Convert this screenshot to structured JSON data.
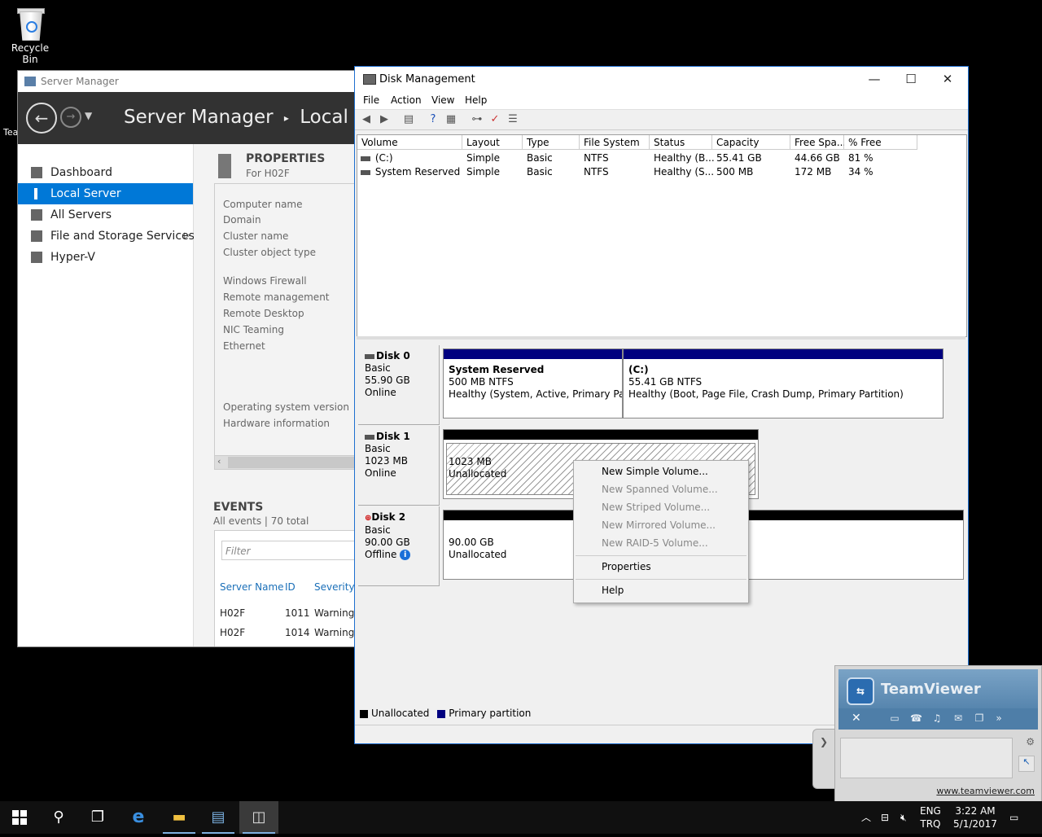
{
  "desktop": {
    "recycle_bin": "Recycle Bin",
    "partial_icon_label": "Tea"
  },
  "server_manager": {
    "window_title": "Server Manager",
    "breadcrumb_root": "Server Manager",
    "breadcrumb_separator": "▸",
    "breadcrumb_current": "Local Serv",
    "nav": [
      {
        "label": "Dashboard",
        "icon": "dashboard-icon"
      },
      {
        "label": "Local Server",
        "icon": "server-icon"
      },
      {
        "label": "All Servers",
        "icon": "servers-icon"
      },
      {
        "label": "File and Storage Services",
        "icon": "storage-icon"
      },
      {
        "label": "Hyper-V",
        "icon": "hyperv-icon"
      }
    ],
    "properties": {
      "heading": "PROPERTIES",
      "subheading": "For H02F",
      "labels": [
        "Computer name",
        "Domain",
        "Cluster name",
        "Cluster object type",
        "Windows Firewall",
        "Remote management",
        "Remote Desktop",
        "NIC Teaming",
        "Ethernet",
        "Operating system version",
        "Hardware information"
      ]
    },
    "events": {
      "heading": "EVENTS",
      "subheading": "All events | 70 total",
      "filter_placeholder": "Filter",
      "columns": [
        "Server Name",
        "ID",
        "Severity"
      ],
      "rows": [
        [
          "H02F",
          "1011",
          "Warning"
        ],
        [
          "H02F",
          "1014",
          "Warning"
        ]
      ]
    }
  },
  "disk_management": {
    "window_title": "Disk Management",
    "menu": [
      "File",
      "Action",
      "View",
      "Help"
    ],
    "columns": [
      "Volume",
      "Layout",
      "Type",
      "File System",
      "Status",
      "Capacity",
      "Free Spa...",
      "% Free"
    ],
    "volumes": [
      [
        "(C:)",
        "Simple",
        "Basic",
        "NTFS",
        "Healthy (B...",
        "55.41 GB",
        "44.66 GB",
        "81 %"
      ],
      [
        "System Reserved",
        "Simple",
        "Basic",
        "NTFS",
        "Healthy (S...",
        "500 MB",
        "172 MB",
        "34 %"
      ]
    ],
    "disks": [
      {
        "name": "Disk 0",
        "type": "Basic",
        "size": "55.90 GB",
        "state": "Online",
        "partitions": [
          {
            "title": "System Reserved",
            "size": "500 MB NTFS",
            "status": "Healthy (System, Active, Primary Partiti"
          },
          {
            "title": "(C:)",
            "size": "55.41 GB NTFS",
            "status": "Healthy (Boot, Page File, Crash Dump, Primary Partition)"
          }
        ]
      },
      {
        "name": "Disk 1",
        "type": "Basic",
        "size": "1023 MB",
        "state": "Online",
        "partitions": [
          {
            "size": "1023 MB",
            "status": "Unallocated"
          }
        ]
      },
      {
        "name": "Disk 2",
        "type": "Basic",
        "size": "90.00 GB",
        "state": "Offline",
        "partitions": [
          {
            "size": "90.00 GB",
            "status": "Unallocated"
          }
        ]
      }
    ],
    "legend": [
      "Unallocated",
      "Primary partition"
    ],
    "colors": {
      "unallocated": "#000000",
      "primary": "#00007f",
      "title_border": "#1e6fd0"
    }
  },
  "context_menu": {
    "items": [
      {
        "label": "New Simple Volume...",
        "enabled": true
      },
      {
        "label": "New Spanned Volume...",
        "enabled": false
      },
      {
        "label": "New Striped Volume...",
        "enabled": false
      },
      {
        "label": "New Mirrored Volume...",
        "enabled": false
      },
      {
        "label": "New RAID-5 Volume...",
        "enabled": false
      },
      {
        "label": "Properties",
        "enabled": true
      },
      {
        "label": "Help",
        "enabled": true
      }
    ]
  },
  "teamviewer": {
    "title": "TeamViewer",
    "link": "www.teamviewer.com"
  },
  "taskbar": {
    "lang_top": "ENG",
    "lang_bottom": "TRQ",
    "time": "3:22 AM",
    "date": "5/1/2017"
  }
}
